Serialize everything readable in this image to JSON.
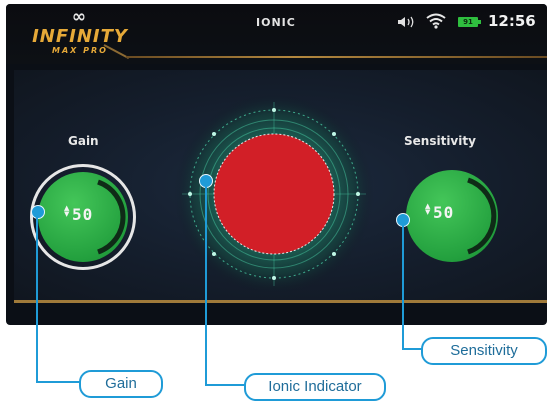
{
  "statusbar": {
    "logo_mark": "∞",
    "logo_title": "INFINITY",
    "logo_subtitle": "MAX PRO",
    "mode": "IONIC",
    "volume_icon": "speaker-icon",
    "wifi_icon": "wifi-icon",
    "battery_level": "91",
    "clock": "12:56"
  },
  "controls": {
    "gain": {
      "label": "Gain",
      "value": "50"
    },
    "sensitivity": {
      "label": "Sensitivity",
      "value": "50"
    }
  },
  "indicator": {
    "state_color": "#d21f27"
  },
  "callouts": {
    "gain": "Gain",
    "ionic": "Ionic Indicator",
    "sensitivity": "Sensitivity"
  },
  "colors": {
    "accent_gold": "#e6a938",
    "knob_green": "#2fb34a",
    "callout_blue": "#1f9bd7"
  }
}
